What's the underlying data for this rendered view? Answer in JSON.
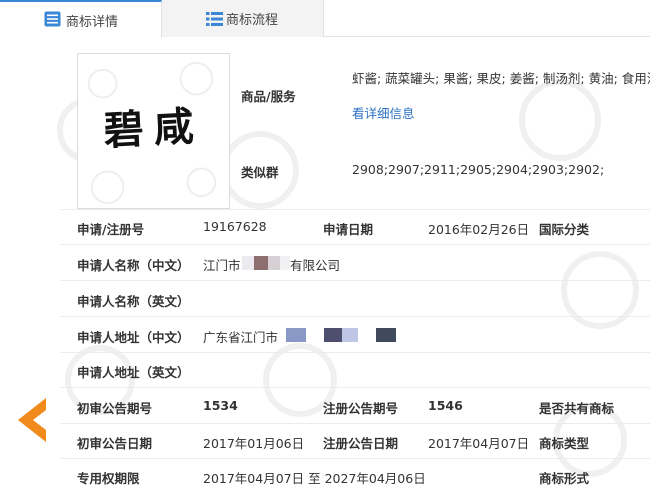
{
  "tabs": [
    {
      "label": "商标详情",
      "icon": "trademark-detail-icon",
      "active": true
    },
    {
      "label": "商标流程",
      "icon": "list-icon",
      "active": false
    }
  ],
  "logo": {
    "text": "碧咸"
  },
  "goods_services": {
    "label": "商品/服务",
    "value": "虾酱; 蔬菜罐头; 果酱; 果皮; 姜酱; 制汤剂; 黄油; 食用油",
    "link": "看详细信息"
  },
  "similar_group": {
    "label": "类似群",
    "value": "2908;2907;2911;2905;2904;2903;2902;"
  },
  "fields": {
    "reg_no_label": "申请/注册号",
    "reg_no_value": "19167628",
    "apply_date_label": "申请日期",
    "apply_date_value": "2016年02月26日",
    "intl_class_label": "国际分类",
    "applicant_cn_label": "申请人名称（中文）",
    "applicant_cn_prefix": "江门市",
    "applicant_cn_suffix": "有限公司",
    "applicant_en_label": "申请人名称（英文）",
    "address_cn_label": "申请人地址（中文）",
    "address_cn_prefix": "广东省江门市",
    "address_en_label": "申请人地址（英文）",
    "prelim_no_label": "初审公告期号",
    "prelim_no_value": "1534",
    "reg_pub_no_label": "注册公告期号",
    "reg_pub_no_value": "1546",
    "shared_label": "是否共有商标",
    "prelim_date_label": "初审公告日期",
    "prelim_date_value": "2017年01月06日",
    "reg_pub_date_label": "注册公告日期",
    "reg_pub_date_value": "2017年04月07日",
    "tm_type_label": "商标类型",
    "exclusive_label": "专用权期限",
    "exclusive_value": "2017年04月07日 至 2027年04月06日",
    "tm_form_label": "商标形式"
  },
  "colors": {
    "accent": "#3a87d6",
    "link": "#2b6fc2",
    "arrow": "#f08a1c"
  }
}
